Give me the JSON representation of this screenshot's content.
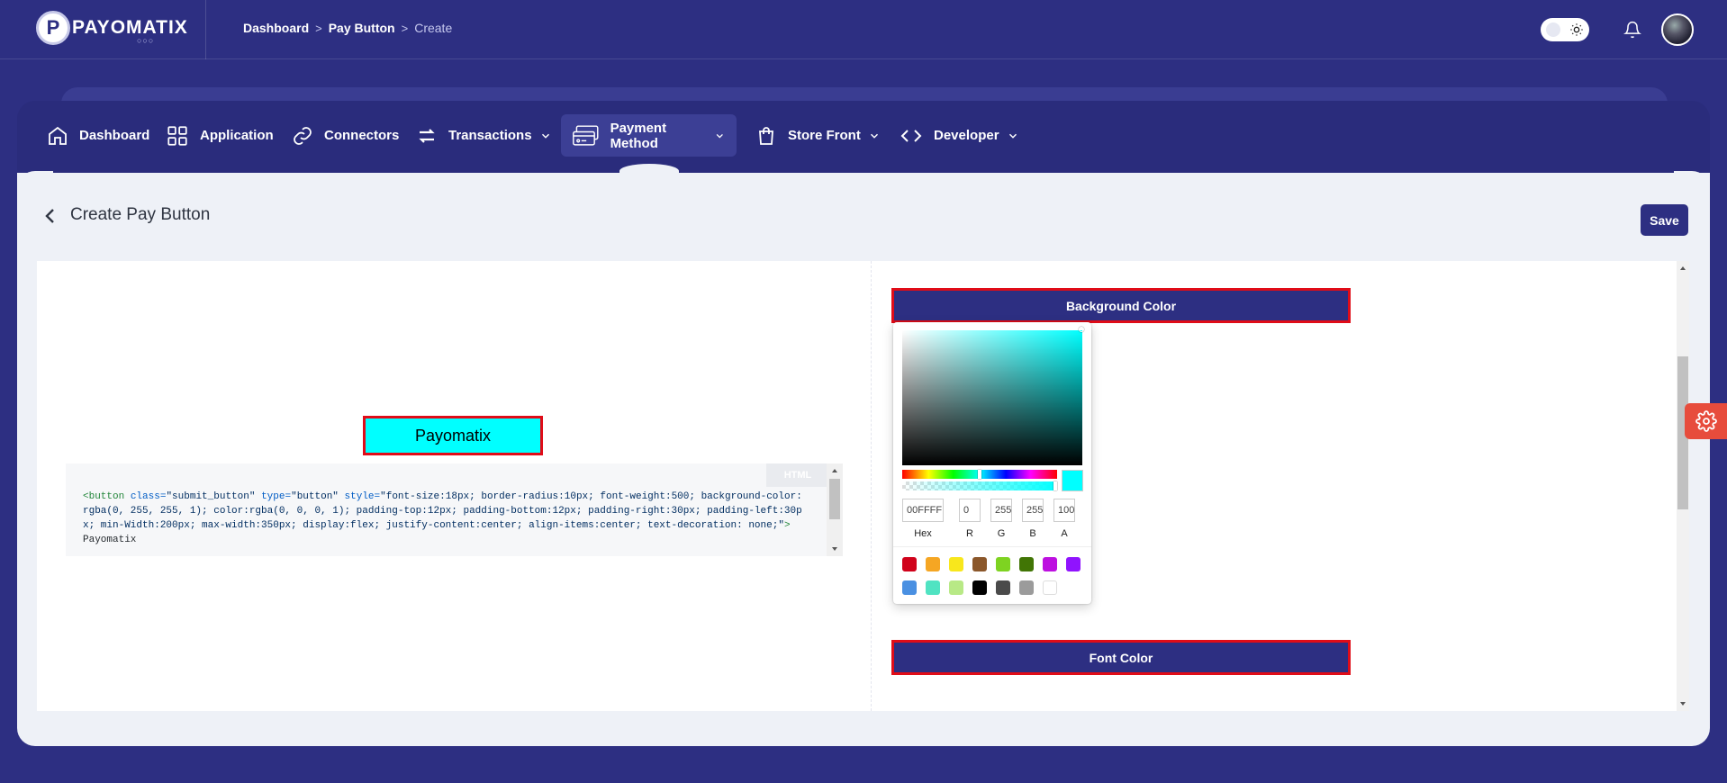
{
  "header": {
    "logo_text": "PAYOMATIX",
    "logo_letter": "P",
    "breadcrumb": [
      "Dashboard",
      "Pay Button",
      "Create"
    ]
  },
  "nav": {
    "items": [
      {
        "label": "Dashboard",
        "icon": "home-icon"
      },
      {
        "label": "Application",
        "icon": "grid-icon"
      },
      {
        "label": "Connectors",
        "icon": "link-icon"
      },
      {
        "label": "Transactions",
        "icon": "transfer-icon",
        "dropdown": true
      },
      {
        "label": "Payment Method",
        "icon": "cards-icon",
        "dropdown": true,
        "active": true
      },
      {
        "label": "Store Front",
        "icon": "shopping-bag-icon",
        "dropdown": true
      },
      {
        "label": "Developer",
        "icon": "code-icon",
        "dropdown": true
      }
    ]
  },
  "page": {
    "title": "Create Pay Button",
    "save_label": "Save"
  },
  "preview": {
    "button_label": "Payomatix",
    "button_bg": "#00ffff",
    "button_text_color": "#000000",
    "border_color": "#e00c18"
  },
  "code": {
    "badge": "HTML",
    "tag_open": "<button",
    "class_attr": "class=",
    "class_val": "\"submit_button\"",
    "type_attr": "type=",
    "type_val": "\"button\"",
    "style_attr": "style=",
    "style_val": "\"font-size:18px; border-radius:10px; font-weight:500; background-color:rgba(0, 255, 255, 1); color:rgba(0, 0, 0, 1); padding-top:12px; padding-bottom:12px; padding-right:30px; padding-left:30px; min-Width:200px; max-width:350px; display:flex; justify-content:center; align-items:center; text-decoration: none;\"",
    "tag_close": ">",
    "inner_text": "Payomatix"
  },
  "settings": {
    "background_label": "Background Color",
    "font_label": "Font Color"
  },
  "picker": {
    "hex": "00FFFF",
    "r": "0",
    "g": "255",
    "b": "255",
    "a": "100",
    "labels": {
      "hex": "Hex",
      "r": "R",
      "g": "G",
      "b": "B",
      "a": "A"
    },
    "presets": [
      "#d0021b",
      "#f5a623",
      "#f8e71c",
      "#8b572a",
      "#7ed321",
      "#417505",
      "#bd10e0",
      "#9013fe",
      "#4a90e2",
      "#50e3c2",
      "#b8e986",
      "#000000",
      "#4a4a4a",
      "#9b9b9b",
      "#ffffff"
    ]
  }
}
